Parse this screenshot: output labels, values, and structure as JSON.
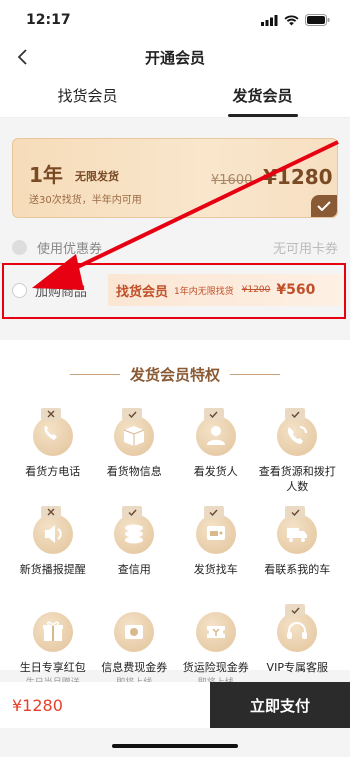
{
  "status": {
    "time": "12:17"
  },
  "nav": {
    "title": "开通会员"
  },
  "tabs": [
    {
      "label": "找货会员"
    },
    {
      "label": "发货会员"
    }
  ],
  "plan": {
    "year": "1年",
    "tag": "无限发货",
    "desc": "送30次找货，半年内可用",
    "old_price": "¥1600",
    "price": "¥1280"
  },
  "coupon": {
    "label": "使用优惠券",
    "value": "无可用卡券"
  },
  "addon": {
    "label": "加购商品",
    "name": "找货会员",
    "sub": "1年内无限找货",
    "old_price": "¥1200",
    "price": "¥560"
  },
  "privileges": {
    "title": "发货会员特权",
    "items": [
      {
        "label": "看货方电话",
        "note": "",
        "icon": "phone-icon",
        "badge": "x"
      },
      {
        "label": "看货物信息",
        "note": "",
        "icon": "box-icon",
        "badge": "check"
      },
      {
        "label": "看发货人",
        "note": "",
        "icon": "person-icon",
        "badge": "check"
      },
      {
        "label": "查看货源和拨打人数",
        "note": "",
        "icon": "phone-call-icon",
        "badge": "check"
      },
      {
        "label": "新货播报提醒",
        "note": "",
        "icon": "speaker-icon",
        "badge": "x"
      },
      {
        "label": "查信用",
        "note": "",
        "icon": "coins-icon",
        "badge": "check"
      },
      {
        "label": "发货找车",
        "note": "",
        "icon": "car-screen-icon",
        "badge": "check"
      },
      {
        "label": "看联系我的车",
        "note": "",
        "icon": "truck-icon",
        "badge": "check"
      },
      {
        "label": "生日专享红包",
        "note": "生日当月赠送",
        "icon": "gift-icon",
        "badge": ""
      },
      {
        "label": "信息费现金券",
        "note": "即将上线",
        "icon": "cash-icon",
        "badge": ""
      },
      {
        "label": "货运险现金券",
        "note": "即将上线",
        "icon": "ticket-icon",
        "badge": ""
      },
      {
        "label": "VIP专属客服",
        "note": "",
        "icon": "headset-icon",
        "badge": "check"
      }
    ]
  },
  "bottom": {
    "price": "¥1280",
    "pay_label": "立即支付"
  }
}
